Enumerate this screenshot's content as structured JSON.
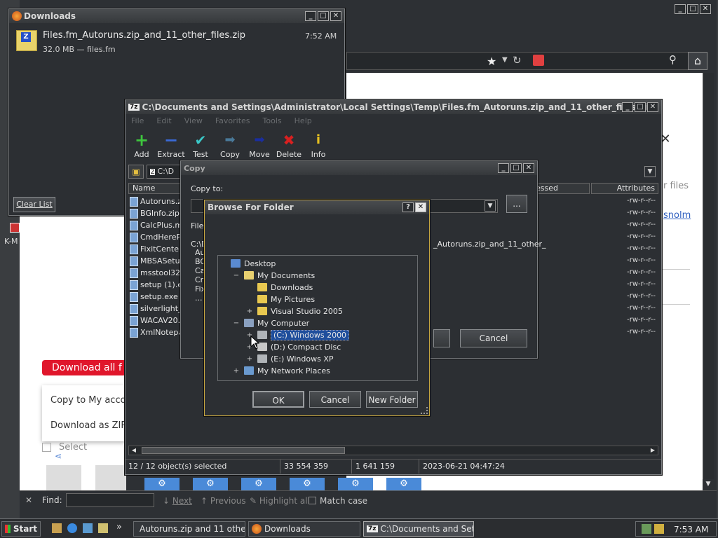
{
  "browser": {
    "download_all_label": "Download all f",
    "menu_copy_label": "Copy to My accou",
    "menu_zip_label": "Download as ZIP",
    "select_label": "Select",
    "right_text1": "r files",
    "right_text2": "snolm",
    "find_label": "Find:",
    "find_next": "Next",
    "find_previous": "Previous",
    "highlight_all": "Highlight all",
    "match_case": "Match case"
  },
  "downloads": {
    "title": "Downloads",
    "file_name": "Files.fm_Autoruns.zip_and_11_other_files.zip",
    "file_meta": "32.0 MB — files.fm",
    "time": "7:52 AM",
    "clear_list": "Clear List"
  },
  "desktop": {
    "label_km": "K-M"
  },
  "zip": {
    "title": "C:\\Documents and Settings\\Administrator\\Local Settings\\Temp\\Files.fm_Autoruns.zip_and_11_other_files.zip\\",
    "menus": [
      "File",
      "Edit",
      "View",
      "Favorites",
      "Tools",
      "Help"
    ],
    "toolbar": [
      "Add",
      "Extract",
      "Test",
      "Copy",
      "Move",
      "Delete",
      "Info"
    ],
    "address": "C:\\D",
    "col_name": "Name",
    "col_accessed": "essed",
    "col_attributes": "Attributes",
    "files": [
      {
        "name": "Autoruns.z",
        "attr": "-rw-r--r--"
      },
      {
        "name": "BGInfo.zip",
        "attr": "-rw-r--r--"
      },
      {
        "name": "CalcPlus.ms",
        "attr": "-rw-r--r--"
      },
      {
        "name": "CmdHerePo",
        "attr": "-rw-r--r--"
      },
      {
        "name": "FixitCenter",
        "attr": "-rw-r--r--"
      },
      {
        "name": "MBSASetup",
        "attr": "-rw-r--r--"
      },
      {
        "name": "msstool32",
        "attr": "-rw-r--r--"
      },
      {
        "name": "setup (1).e",
        "attr": "-rw-r--r--"
      },
      {
        "name": "setup.exe",
        "attr": "-rw-r--r--"
      },
      {
        "name": "silverlight_",
        "attr": "-rw-r--r--"
      },
      {
        "name": "WACAV20.",
        "attr": "-rw-r--r--"
      },
      {
        "name": "XmlNotepac",
        "attr": "-rw-r--r--"
      }
    ],
    "status": {
      "selected": "12 / 12 object(s) selected",
      "size": "33 554 359",
      "packed": "1 641 159",
      "date": "2023-06-21 04:47:24"
    }
  },
  "copy": {
    "title": "Copy",
    "copy_to": "Copy to:",
    "browse_btn": "...",
    "files_label": "Files",
    "path_partial": "C:\\D",
    "path_right": "_Autoruns.zip_and_11_other_",
    "list_partial": [
      "Au",
      "BG",
      "Ca",
      "Cn",
      "Fix",
      "..."
    ],
    "cancel": "Cancel"
  },
  "bff": {
    "title": "Browse For Folder",
    "help": "?",
    "tree": [
      {
        "label": "Desktop",
        "indent": 0,
        "pm": "",
        "icon": "desktop"
      },
      {
        "label": "My Documents",
        "indent": 1,
        "pm": "−",
        "icon": "docs"
      },
      {
        "label": "Downloads",
        "indent": 2,
        "pm": "",
        "icon": "folder"
      },
      {
        "label": "My Pictures",
        "indent": 2,
        "pm": "",
        "icon": "pictures"
      },
      {
        "label": "Visual Studio 2005",
        "indent": 2,
        "pm": "+",
        "icon": "folder"
      },
      {
        "label": "My Computer",
        "indent": 1,
        "pm": "−",
        "icon": "computer"
      },
      {
        "label": "(C:) Windows 2000",
        "indent": 2,
        "pm": "+",
        "icon": "drive",
        "selected": true
      },
      {
        "label": "(D:) Compact Disc",
        "indent": 2,
        "pm": "+",
        "icon": "cd"
      },
      {
        "label": "(E:) Windows XP",
        "indent": 2,
        "pm": "+",
        "icon": "drive"
      },
      {
        "label": "My Network Places",
        "indent": 1,
        "pm": "+",
        "icon": "network"
      }
    ],
    "ok": "OK",
    "cancel": "Cancel",
    "new_folder": "New Folder"
  },
  "taskbar": {
    "start": "Start",
    "tasks": [
      "Autoruns.zip and 11 othe...",
      "Downloads",
      "C:\\Documents and Set..."
    ],
    "clock": "7:53 AM"
  },
  "colors": {
    "accent_red": "#e0162b",
    "selection": "#1f4e9c",
    "gold_border": "#c7a640"
  }
}
